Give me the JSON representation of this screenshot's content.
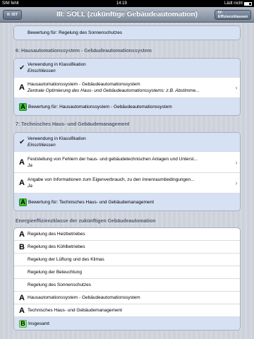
{
  "statusbar": {
    "carrier": "SIM fehlt",
    "time": "14:19",
    "battery": "Lädt nicht"
  },
  "navbar": {
    "title": "III: SOLL (zukünftige Gebäudeautomation)",
    "back_label": "II: IST",
    "forward_label": "IV: Effizienzklassen"
  },
  "top_group": {
    "row": "Bewertung für: Regelung des Sonnenschutzes"
  },
  "section6": {
    "header": "6: Hausautomationssystem - Gebäudeautomationssystem",
    "usage_label": "Verwendung in Klassifikation",
    "usage_value": "Einschliessen",
    "item_grade": "A",
    "item_title": "Hausautomationssystem - Gebäudeautomationssystem",
    "item_sub": "Zentrale Optimierung des Haus- und Gebäudeautomationssystems: z.B. Abstimme...",
    "rating_grade": "A",
    "rating_label": "Bewertung für: Hausautomationssystem - Gebäudeautomationssystem"
  },
  "section7": {
    "header": "7: Technisches Haus- und Gebäudemanagement",
    "usage_label": "Verwendung in Klassifikation",
    "usage_value": "Einschliessen",
    "items": [
      {
        "grade": "A",
        "title": "Feststellung von Fehlern der haus- und gebäudetechnischen Anlagen und Unterst...",
        "value": "Ja"
      },
      {
        "grade": "A",
        "title": "Angabe von Informationen zum Eigenverbrauch, zu den Innenraumbedingungen...",
        "value": "Ja"
      }
    ],
    "rating_grade": "A",
    "rating_label": "Bewertung für: Technisches Haus- und Gebäudemanagement"
  },
  "efficiency": {
    "header": "Energieeffizienzklasse der zukünftigen Gebäudeautomation",
    "rows": [
      {
        "grade": "A",
        "label": "Regelung des Heizbetriebes"
      },
      {
        "grade": "B",
        "label": "Regelung des Kühlbetriebes"
      },
      {
        "grade": "",
        "label": "Regelung der Lüftung und des Klimas"
      },
      {
        "grade": "",
        "label": "Regelung der Beleuchtung"
      },
      {
        "grade": "",
        "label": "Regelung des Sonnenschutzes"
      },
      {
        "grade": "A",
        "label": "Hausautomationssystem - Gebäudeautomationssystem"
      },
      {
        "grade": "A",
        "label": "Technisches Haus- und Gebäudemanagement"
      }
    ],
    "total_grade": "B",
    "total_label": "Insgesamt"
  }
}
